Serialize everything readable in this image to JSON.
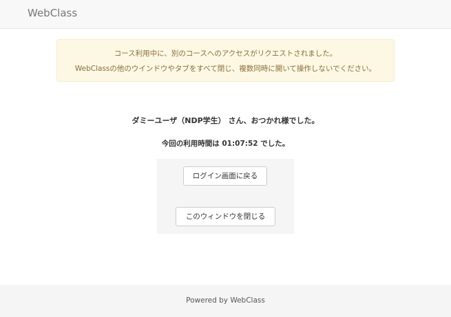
{
  "navbar": {
    "brand": "WebClass"
  },
  "alert": {
    "line1": "コース利用中に、別のコースへのアクセスがリクエストされました。",
    "line2": "WebClassの他のウインドウやタブをすべて閉じ、複数同時に開いて操作しないでください。"
  },
  "main": {
    "greeting": "ダミーユーザ（NDP学生） さん、おつかれ様でした。",
    "usage_time": "今回の利用時間は 01:07:52 でした。"
  },
  "actions": {
    "login_label": "ログイン画面に戻る",
    "close_label": "このウィンドウを閉じる"
  },
  "footer": {
    "text": "Powered by WebClass"
  }
}
